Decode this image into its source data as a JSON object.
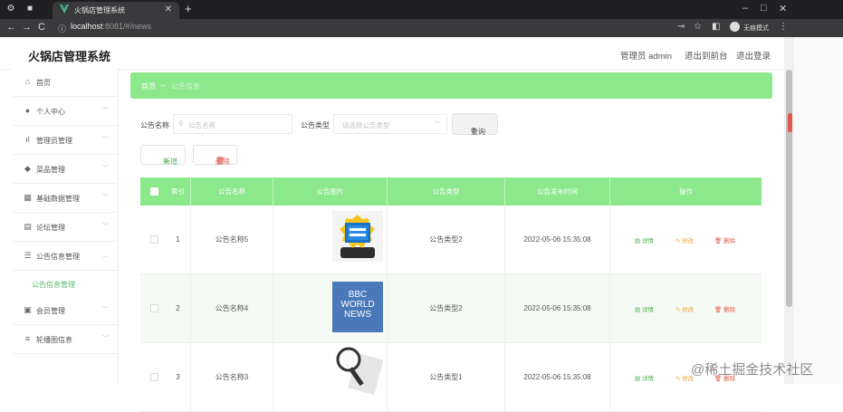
{
  "browser": {
    "tab_title": "火锅店管理系统",
    "url_host": "localhost",
    "url_path": ":8081/#/news",
    "incognito_label": "无痕模式"
  },
  "header": {
    "app_title": "火锅店管理系统",
    "admin_label": "管理员 admin",
    "to_frontend": "退出到前台",
    "logout": "退出登录"
  },
  "sidebar": {
    "items": [
      {
        "label": "首页",
        "icon": "home-icon"
      },
      {
        "label": "个人中心",
        "icon": "user-icon"
      },
      {
        "label": "管理员管理",
        "icon": "bar-chart-icon"
      },
      {
        "label": "菜品管理",
        "icon": "dish-icon"
      },
      {
        "label": "基础数据管理",
        "icon": "grid-icon"
      },
      {
        "label": "论坛管理",
        "icon": "forum-icon"
      },
      {
        "label": "公告信息管理",
        "icon": "notice-icon"
      },
      {
        "label": "会员管理",
        "icon": "member-icon"
      },
      {
        "label": "轮播图信息",
        "icon": "list-icon"
      }
    ],
    "submenu_label": "公告信息管理"
  },
  "breadcrumb": {
    "home": "首页",
    "current": "公告信息"
  },
  "filters": {
    "name_label": "公告名称",
    "name_placeholder": "公告名称",
    "type_label": "公告类型",
    "type_placeholder": "请选择公告类型",
    "search_label": "查询"
  },
  "actions": {
    "add_label": "新增",
    "delete_label": "删除"
  },
  "table": {
    "headers": [
      "索引",
      "公告名称",
      "公告图片",
      "公告类型",
      "公告发布时间",
      "操作"
    ],
    "rows": [
      {
        "index": "1",
        "name": "公告名称5",
        "image": "news-badge-image",
        "type": "公告类型2",
        "time": "2022-05-06 15:35:08"
      },
      {
        "index": "2",
        "name": "公告名称4",
        "image": "bbc-world-news-image",
        "image_text": "BBC WORLD NEWS",
        "type": "公告类型2",
        "time": "2022-05-06 15:35:08"
      },
      {
        "index": "3",
        "name": "公告名称3",
        "image": "magnifier-news-image",
        "type": "公告类型1",
        "time": "2022-05-06 15:35:08"
      }
    ],
    "op_detail": "详情",
    "op_edit": "修改",
    "op_delete": "删除"
  },
  "colors": {
    "accent": "#8be88b",
    "detail": "#4caf50",
    "edit": "#f0a53a",
    "delete": "#e05a4b"
  },
  "watermark": "@稀土掘金技术社区"
}
